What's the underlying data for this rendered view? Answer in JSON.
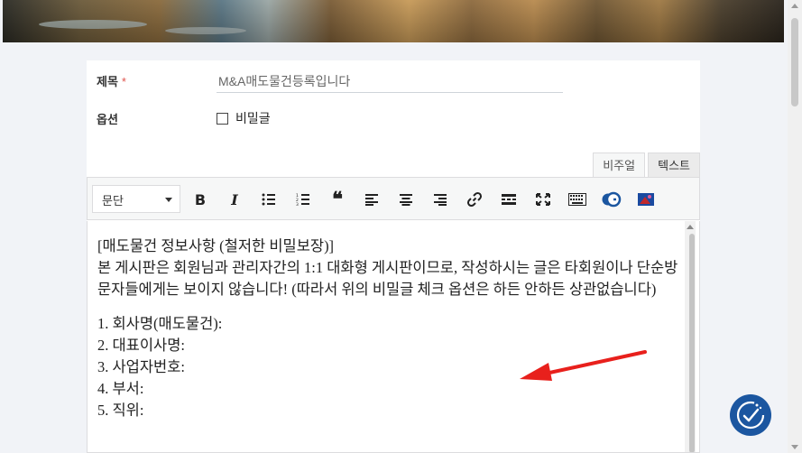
{
  "form": {
    "title_label": "제목",
    "required_mark": "*",
    "title_value": "M&A매도물건등록입니다",
    "option_label": "옵션",
    "secret_label": "비밀글"
  },
  "editor": {
    "tabs": [
      {
        "label": "비주얼",
        "active": true
      },
      {
        "label": "텍스트",
        "active": false
      }
    ],
    "format_select": "문단",
    "toolbar_icons": [
      "bold-icon",
      "italic-icon",
      "bullet-list-icon",
      "numbered-list-icon",
      "blockquote-icon",
      "align-left-icon",
      "align-center-icon",
      "align-right-icon",
      "link-icon",
      "read-more-icon",
      "fullscreen-icon",
      "keyboard-icon",
      "grammar-check-icon",
      "image-icon"
    ],
    "toolbar_glyphs": {
      "bold": "B",
      "italic": "I",
      "quote": "❝"
    },
    "content": {
      "line1": "[매도물건 정보사항 (철저한 비밀보장)]",
      "line2": "본 게시판은 회원님과 관리자간의 1:1 대화형 게시판이므로, 작성하시는 글은 타회원이나 단순방문자들에게는 보이지 않습니다! (따라서 위의 비밀글 체크 옵션은 하든 안하든 상관없습니다)",
      "items": [
        "1. 회사명(매도물건):",
        "2. 대표이사명:",
        "3. 사업자번호:",
        "4. 부서:",
        "5. 직위:"
      ]
    }
  },
  "colors": {
    "accent": "#1b56a0",
    "required": "#e0544d",
    "annotation_arrow": "#e8201c"
  }
}
